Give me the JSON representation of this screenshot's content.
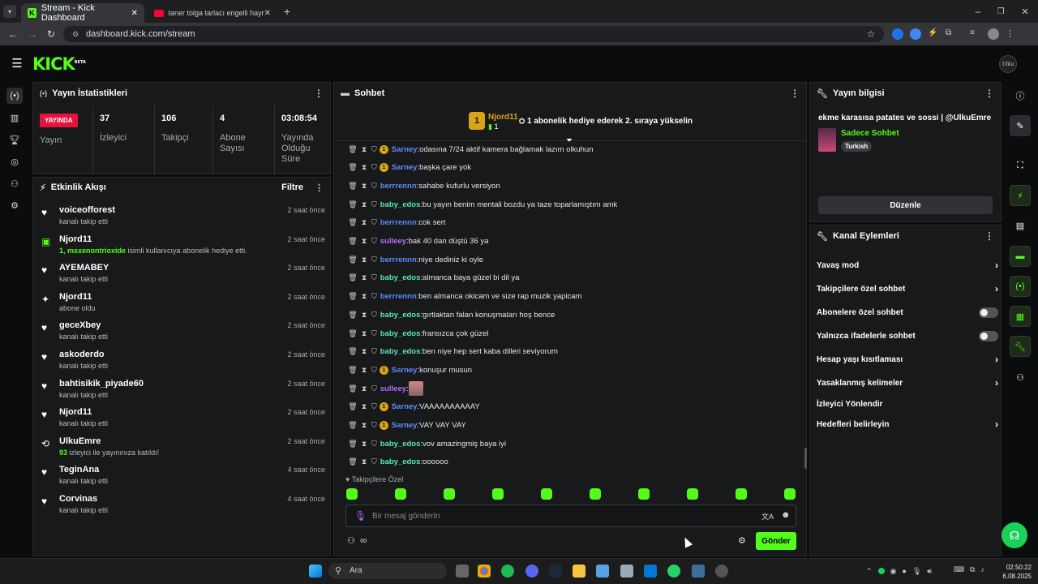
{
  "browser": {
    "tabs": [
      {
        "label": "Stream - Kick Dashboard"
      },
      {
        "label": "taner tolga tarlacı engelli hayra"
      }
    ],
    "url": "dashboard.kick.com/stream"
  },
  "header": {
    "logo": "KICK",
    "logo_sup": "BETA",
    "avatar_text": "Ulku"
  },
  "stats": {
    "title": "Yayın İstatistikleri",
    "live_badge": "YAYINDA",
    "live_label": "Yayın",
    "items": [
      {
        "value": "37",
        "label": "İzleyici"
      },
      {
        "value": "106",
        "label": "Takipçi"
      },
      {
        "value": "4",
        "label": "Abone Sayısı"
      },
      {
        "value": "03:08:54",
        "label": "Yayında Olduğu Süre"
      }
    ]
  },
  "activity": {
    "title": "Etkinlik Akışı",
    "filter": "Filtre",
    "items": [
      {
        "name": "voiceofforest",
        "desc": "kanalı takip etti",
        "time": "2 saat önce",
        "icon": "heart-icon"
      },
      {
        "name": "Njord11",
        "desc_hl": "1, msxenontrioxide",
        "desc": "isimli kullanıcıya abonelik hediye etti.",
        "time": "2 saat önce",
        "icon": "gift-icon"
      },
      {
        "name": "AYEMABEY",
        "desc": "kanalı takip etti",
        "time": "2 saat önce",
        "icon": "heart-icon"
      },
      {
        "name": "Njord11",
        "desc": "abone oldu",
        "time": "2 saat önce",
        "icon": "star-icon"
      },
      {
        "name": "geceXbey",
        "desc": "kanalı takip etti",
        "time": "2 saat önce",
        "icon": "heart-icon"
      },
      {
        "name": "askoderdo",
        "desc": "kanalı takip etti",
        "time": "2 saat önce",
        "icon": "heart-icon"
      },
      {
        "name": "bahtisikik_piyade60",
        "desc": "kanalı takip etti",
        "time": "2 saat önce",
        "icon": "heart-icon"
      },
      {
        "name": "Njord11",
        "desc": "kanalı takip etti",
        "time": "2 saat önce",
        "icon": "heart-icon"
      },
      {
        "name": "UlkuEmre",
        "desc_hl": "93",
        "desc": "izleyici ile yayınınıza katıldı!",
        "time": "2 saat önce",
        "icon": "raid-icon"
      },
      {
        "name": "TeginAna",
        "desc": "kanalı takip etti",
        "time": "4 saat önce",
        "icon": "heart-icon"
      },
      {
        "name": "Corvinas",
        "desc": "kanalı takip etti",
        "time": "4 saat önce",
        "icon": "heart-icon"
      }
    ]
  },
  "chat": {
    "title": "Sohbet",
    "pinned_user": "Njord11",
    "pinned_count": "1",
    "pinned_text": "1 abonelik hediye ederek 2. sıraya yükselin",
    "messages": [
      {
        "user": "Sarney",
        "badge": "1",
        "text": "odasına 7/24 aktif kamera bağlamak lazım olkuhun",
        "color": "#5c8cff"
      },
      {
        "user": "Sarney",
        "badge": "1",
        "text": "başka çare yok",
        "color": "#5c8cff"
      },
      {
        "user": "berrrennn",
        "text": "sahabe kufurlu versiyon",
        "color": "#5c8cff"
      },
      {
        "user": "baby_edos",
        "text": "bu yayın benim mentali bozdu ya taze toparlamıştım amk",
        "color": "#58e6b7"
      },
      {
        "user": "berrrennn",
        "text": "cok sert",
        "color": "#5c8cff"
      },
      {
        "user": "sulleey",
        "text": "bak 40 dan düştü 36 ya",
        "color": "#b86cff"
      },
      {
        "user": "berrrennn",
        "text": "niye dediniz ki oyle",
        "color": "#5c8cff"
      },
      {
        "user": "baby_edos",
        "text": "almanca baya güzel bi dil ya",
        "color": "#58e6b7"
      },
      {
        "user": "berrrennn",
        "text": "ben almanca okicam ve size rap muzik yapicam",
        "color": "#5c8cff"
      },
      {
        "user": "baby_edos",
        "text": "gırtlaktan falan konuşmaları hoş bence",
        "color": "#58e6b7"
      },
      {
        "user": "baby_edos",
        "text": "fransızca çok güzel",
        "color": "#58e6b7"
      },
      {
        "user": "baby_edos",
        "text": "ben niye hep sert kaba dilleri seviyorum",
        "color": "#58e6b7"
      },
      {
        "user": "Sarney",
        "badge": "1",
        "text": "konuşur musun",
        "color": "#5c8cff"
      },
      {
        "user": "sulleey",
        "text": "",
        "emote": true,
        "color": "#b86cff"
      },
      {
        "user": "Sarney",
        "badge": "1",
        "text": "VAAAAAAAAAAY",
        "color": "#5c8cff"
      },
      {
        "user": "Sarney",
        "badge": "1",
        "text": "VAY VAY VAY",
        "color": "#5c8cff"
      },
      {
        "user": "baby_edos",
        "text": "vov amazingmiş baya iyi",
        "color": "#58e6b7"
      },
      {
        "user": "baby_edos",
        "text": "oooooo",
        "color": "#58e6b7"
      }
    ],
    "followers_only": "Takipçilere Özel",
    "input_placeholder": "Bir mesaj gönderin",
    "send": "Gönder"
  },
  "stream_info": {
    "title": "Yayın bilgisi",
    "stream_title": "ekme karasısa patates ve sossi | @UlkuEmre",
    "category": "Sadece Sohbet",
    "language": "Turkish",
    "edit": "Düzenle"
  },
  "channel_actions": {
    "title": "Kanal Eylemleri",
    "items": [
      {
        "label": "Yavaş mod",
        "type": "chevron"
      },
      {
        "label": "Takipçilere özel sohbet",
        "type": "chevron"
      },
      {
        "label": "Abonelere özel sohbet",
        "type": "toggle"
      },
      {
        "label": "Yalnızca ifadelerle sohbet",
        "type": "toggle"
      },
      {
        "label": "Hesap yaşı kısıtlaması",
        "type": "chevron"
      },
      {
        "label": "Yasaklanmış kelimeler",
        "type": "chevron"
      },
      {
        "label": "İzleyici Yönlendir",
        "type": "none"
      },
      {
        "label": "Hedefleri belirleyin",
        "type": "chevron"
      }
    ]
  },
  "taskbar": {
    "search": "Ara",
    "time": "02:50:22",
    "date": "6.08.2025"
  },
  "colors": {
    "accent": "#53fc18",
    "live": "#e4143c",
    "bg": "#0b0c0d",
    "panel": "#18191b"
  }
}
